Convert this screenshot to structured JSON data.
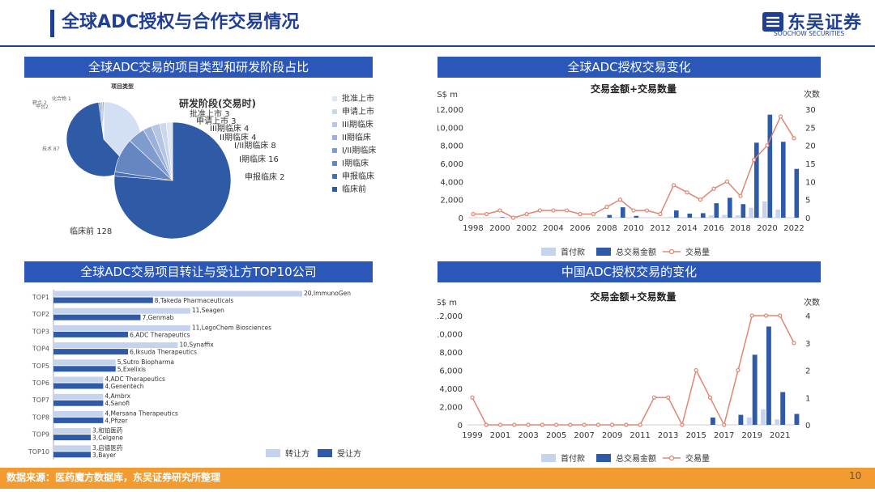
{
  "header": {
    "title": "全球ADC授权与合作交易情况",
    "logo_cn": "东吴证券",
    "logo_en": "SOOCHOW SECURITIES",
    "logo_abbr": "SCS"
  },
  "panels": {
    "p1_title": "全球ADC交易的项目类型和研发阶段占比",
    "p2_title": "全球ADC授权交易变化",
    "p3_title": "全球ADC交易项目转让与受让方TOP10公司",
    "p4_title": "中国ADC授权交易的变化"
  },
  "colors": {
    "accent": "#1f3f94",
    "band": "#2b58b8",
    "footer": "#f29b30",
    "bar_light": "#c5d3ec",
    "bar_dark": "#2f5aa8",
    "line": "#e08572"
  },
  "footer": {
    "source": "数据来源：医药魔方数据库，东吴证券研究所整理",
    "page": "10"
  },
  "chart_data": [
    {
      "id": "type",
      "type": "pie",
      "title": "项目类型",
      "slices": [
        {
          "label": "技术 87",
          "value": 87,
          "color": "#d3dff2"
        },
        {
          "label": "药物 136",
          "value": 136,
          "color": "#2e5aa6"
        },
        {
          "label": "平台2",
          "value": 2,
          "color": "#7f9fd4"
        },
        {
          "label": "靶点 2",
          "value": 2,
          "color": "#aebedf"
        },
        {
          "label": "化合物 1",
          "value": 1,
          "color": "#5b7fbd"
        }
      ]
    },
    {
      "id": "stage",
      "type": "pie",
      "title": "研发阶段(交易时)",
      "slices": [
        {
          "label": "临床前 128",
          "legend": "临床前",
          "value": 128,
          "color": "#2f5ba6"
        },
        {
          "label": "申报临床 2",
          "legend": "申报临床",
          "value": 2,
          "color": "#4a6eb3"
        },
        {
          "label": "I期临床 16",
          "legend": "I期临床",
          "value": 16,
          "color": "#6586c1"
        },
        {
          "label": "I/II期临床 8",
          "legend": "I/II期临床",
          "value": 8,
          "color": "#809ccd"
        },
        {
          "label": "II期临床 4",
          "legend": "II期临床",
          "value": 4,
          "color": "#9bb1d9"
        },
        {
          "label": "III期临床 4",
          "legend": "III期临床",
          "value": 4,
          "color": "#b5c6e4"
        },
        {
          "label": "申请上市 3",
          "legend": "申请上市",
          "value": 3,
          "color": "#cbd7ec"
        },
        {
          "label": "批准上市 3",
          "legend": "批准上市",
          "value": 3,
          "color": "#dfe7f4"
        }
      ]
    },
    {
      "id": "global",
      "type": "bar",
      "title": "交易金额+交易数量",
      "y_left_unit": "US$ m",
      "y_right_unit": "次数",
      "ylim_left": [
        0,
        12000
      ],
      "ylim_right": [
        0,
        30
      ],
      "left_ticks": [
        "0",
        "2,000",
        "4,000",
        "6,000",
        "8,000",
        "10,000",
        "12,000"
      ],
      "right_ticks": [
        "0",
        "5",
        "10",
        "15",
        "20",
        "25",
        "30"
      ],
      "years": [
        1998,
        1999,
        2000,
        2001,
        2002,
        2003,
        2004,
        2005,
        2006,
        2007,
        2008,
        2009,
        2010,
        2011,
        2012,
        2013,
        2014,
        2015,
        2016,
        2017,
        2018,
        2019,
        2020,
        2021,
        2022
      ],
      "x_tick_labels": [
        "1998",
        "2000",
        "2002",
        "2004",
        "2006",
        "2008",
        "2010",
        "2012",
        "2014",
        "2016",
        "2018",
        "2020",
        "2022"
      ],
      "series": [
        {
          "name": "首付款",
          "values": [
            0,
            0,
            0,
            0,
            0,
            0,
            0,
            0,
            0,
            0,
            20,
            40,
            0,
            0,
            50,
            100,
            60,
            60,
            250,
            300,
            250,
            1100,
            1800,
            900,
            0
          ]
        },
        {
          "name": "总交易金额",
          "values": [
            0,
            0,
            60,
            0,
            0,
            0,
            0,
            0,
            0,
            0,
            300,
            1150,
            200,
            0,
            0,
            800,
            450,
            500,
            1600,
            2200,
            1500,
            8300,
            11400,
            8400,
            5400
          ]
        },
        {
          "name": "交易量",
          "values": [
            1,
            1,
            2,
            0,
            1,
            2,
            2,
            2,
            1,
            1,
            3,
            5,
            2,
            2,
            1,
            9,
            7,
            5,
            8,
            10,
            6,
            16,
            20,
            28,
            22
          ]
        }
      ]
    },
    {
      "id": "top10",
      "type": "bar",
      "orientation": "horizontal",
      "groups": [
        "TOP1",
        "TOP2",
        "TOP3",
        "TOP4",
        "TOP5",
        "TOP6",
        "TOP7",
        "TOP8",
        "TOP9",
        "TOP10"
      ],
      "series_names": [
        "转让方",
        "受让方"
      ],
      "transferors": [
        {
          "value": 20,
          "label": "20,ImmunoGen"
        },
        {
          "value": 11,
          "label": "11,Seagen"
        },
        {
          "value": 11,
          "label": "11,LegoChem Biosciences"
        },
        {
          "value": 10,
          "label": "10,Synaffix"
        },
        {
          "value": 5,
          "label": "5,Sutro Biopharma"
        },
        {
          "value": 4,
          "label": "4,ADC Therapeutics"
        },
        {
          "value": 4,
          "label": "4,Ambrx"
        },
        {
          "value": 4,
          "label": "4,Mersana Therapeutics"
        },
        {
          "value": 3,
          "label": "3,和铂医药"
        },
        {
          "value": 3,
          "label": "3,启德医药"
        }
      ],
      "transferees": [
        {
          "value": 8,
          "label": "8,Takeda Pharmaceuticals"
        },
        {
          "value": 7,
          "label": "7,Genmab"
        },
        {
          "value": 6,
          "label": "6,ADC Therapeutics"
        },
        {
          "value": 6,
          "label": "6,Iksuda Therapeutics"
        },
        {
          "value": 5,
          "label": "5,Exelixis"
        },
        {
          "value": 4,
          "label": "4,Genentech"
        },
        {
          "value": 4,
          "label": "4,Sanofi"
        },
        {
          "value": 4,
          "label": "4,Pfizer"
        },
        {
          "value": 3,
          "label": "3,Celgene"
        },
        {
          "value": 3,
          "label": "3,Bayer"
        }
      ]
    },
    {
      "id": "china",
      "type": "bar",
      "title": "交易金额+交易数量",
      "y_left_unit": "US$ m",
      "y_right_unit": "次数",
      "ylim_left": [
        0,
        12000
      ],
      "ylim_right": [
        0,
        4
      ],
      "left_ticks": [
        "0",
        "2,000",
        "4,000",
        "6,000",
        "8,000",
        "10,000",
        "12,000"
      ],
      "right_ticks": [
        "0",
        "1",
        "2",
        "3",
        "4"
      ],
      "years": [
        1999,
        2000,
        2001,
        2002,
        2003,
        2004,
        2005,
        2006,
        2007,
        2008,
        2009,
        2010,
        2011,
        2012,
        2013,
        2014,
        2015,
        2016,
        2017,
        2018,
        2019,
        2020,
        2021,
        2022
      ],
      "x_tick_labels": [
        "1999",
        "2001",
        "2003",
        "2005",
        "2007",
        "2009",
        "2011",
        "2013",
        "2015",
        "2017",
        "2019",
        "2021"
      ],
      "series": [
        {
          "name": "首付款",
          "values": [
            0,
            0,
            0,
            0,
            0,
            0,
            0,
            0,
            0,
            0,
            0,
            0,
            0,
            0,
            0,
            0,
            0,
            0,
            0,
            0,
            800,
            1700,
            600,
            0
          ]
        },
        {
          "name": "总交易金额",
          "values": [
            0,
            0,
            0,
            0,
            0,
            0,
            0,
            0,
            0,
            0,
            0,
            0,
            0,
            0,
            0,
            0,
            0,
            800,
            0,
            1100,
            7700,
            10800,
            3600,
            1200
          ]
        },
        {
          "name": "交易量",
          "values": [
            1,
            0,
            0,
            0,
            0,
            0,
            0,
            0,
            0,
            0,
            0,
            0,
            0,
            1,
            1,
            0,
            2,
            1,
            0,
            2,
            4,
            4,
            4,
            3
          ]
        }
      ]
    }
  ]
}
